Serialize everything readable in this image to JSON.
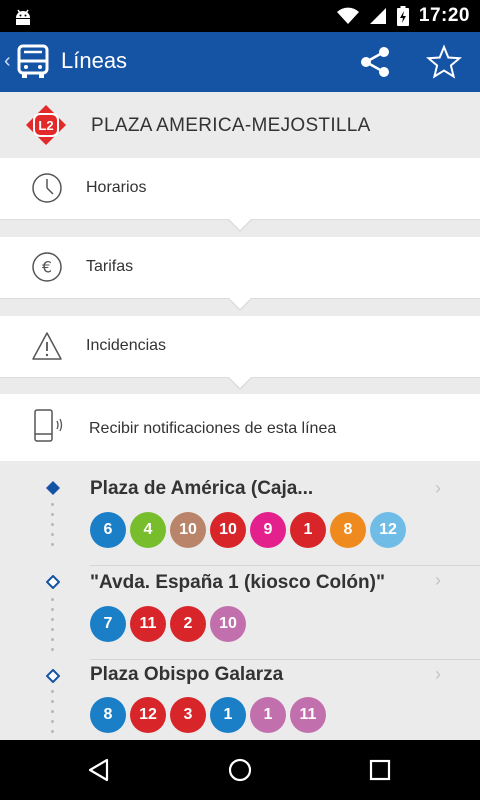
{
  "status_bar": {
    "time": "17:20",
    "icons": [
      "android-debug-icon",
      "wifi-icon",
      "signal-icon",
      "battery-charging-icon"
    ]
  },
  "app_bar": {
    "title": "Líneas",
    "back_glyph": "‹",
    "icons": [
      "bus-icon",
      "share-icon",
      "star-icon"
    ]
  },
  "line": {
    "badge": "L2",
    "badge_color": "#e32a2a",
    "name": "PLAZA AMERICA-MEJOSTILLA"
  },
  "menu": [
    {
      "label": "Horarios",
      "icon": "clock-icon"
    },
    {
      "label": "Tarifas",
      "icon": "euro-icon"
    },
    {
      "label": "Incidencias",
      "icon": "warning-icon"
    }
  ],
  "notification": {
    "label": "Recibir notificaciones de esta línea",
    "icon": "phone-vibrate-icon"
  },
  "stops": [
    {
      "name": "Plaza de América (Caja...",
      "current": true,
      "lines": [
        {
          "label": "6",
          "color": "#1a7fc7"
        },
        {
          "label": "4",
          "color": "#78bd2c"
        },
        {
          "label": "10",
          "color": "#b98469"
        },
        {
          "label": "10",
          "color": "#d7252a"
        },
        {
          "label": "9",
          "color": "#e3208c"
        },
        {
          "label": "1",
          "color": "#d7252a"
        },
        {
          "label": "8",
          "color": "#ee8a1e"
        },
        {
          "label": "12",
          "color": "#6fbde6"
        }
      ]
    },
    {
      "name": "\"Avda. España 1 (kiosco Colón)\"",
      "current": false,
      "lines": [
        {
          "label": "7",
          "color": "#1a7fc7"
        },
        {
          "label": "11",
          "color": "#d7252a"
        },
        {
          "label": "2",
          "color": "#d7252a"
        },
        {
          "label": "10",
          "color": "#c170ad"
        }
      ]
    },
    {
      "name": "Plaza Obispo Galarza",
      "current": false,
      "lines": [
        {
          "label": "8",
          "color": "#1a7fc7"
        },
        {
          "label": "12",
          "color": "#d7252a"
        },
        {
          "label": "3",
          "color": "#d7252a"
        },
        {
          "label": "1",
          "color": "#1a7fc7"
        },
        {
          "label": "1",
          "color": "#c170ad"
        },
        {
          "label": "11",
          "color": "#c170ad"
        }
      ]
    }
  ],
  "colors": {
    "app_bar": "#1553a5",
    "stop_marker": "#1553a5"
  },
  "nav_bar": {
    "icons": [
      "back-nav-icon",
      "home-nav-icon",
      "recents-nav-icon"
    ]
  }
}
